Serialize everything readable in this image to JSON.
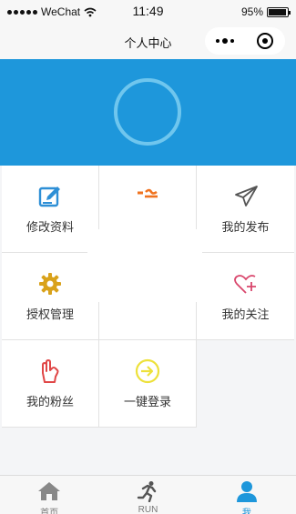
{
  "status_bar": {
    "carrier": "WeChat",
    "time": "11:49",
    "battery": "95%",
    "battery_level": 0.95
  },
  "nav": {
    "title": "个人中心"
  },
  "menu": [
    {
      "label": "修改资料",
      "icon": "edit-profile-icon"
    },
    {
      "label": "",
      "icon": "feedback-icon"
    },
    {
      "label": "我的发布",
      "icon": "paper-plane-icon"
    },
    {
      "label": "授权管理",
      "icon": "gear-icon"
    },
    {
      "label": "",
      "icon": "about-icon"
    },
    {
      "label": "我的关注",
      "icon": "heart-plus-icon"
    },
    {
      "label": "我的粉丝",
      "icon": "hand-icon"
    },
    {
      "label": "一键登录",
      "icon": "login-arrow-icon"
    }
  ],
  "tab_bar": [
    {
      "label": "首页",
      "icon": "home-icon"
    },
    {
      "label": "RUN",
      "icon": "runner-icon"
    },
    {
      "label": "我",
      "icon": "person-icon",
      "active": true
    }
  ],
  "colors": {
    "accent": "#1e97db",
    "ring": "#6fc6ee"
  }
}
